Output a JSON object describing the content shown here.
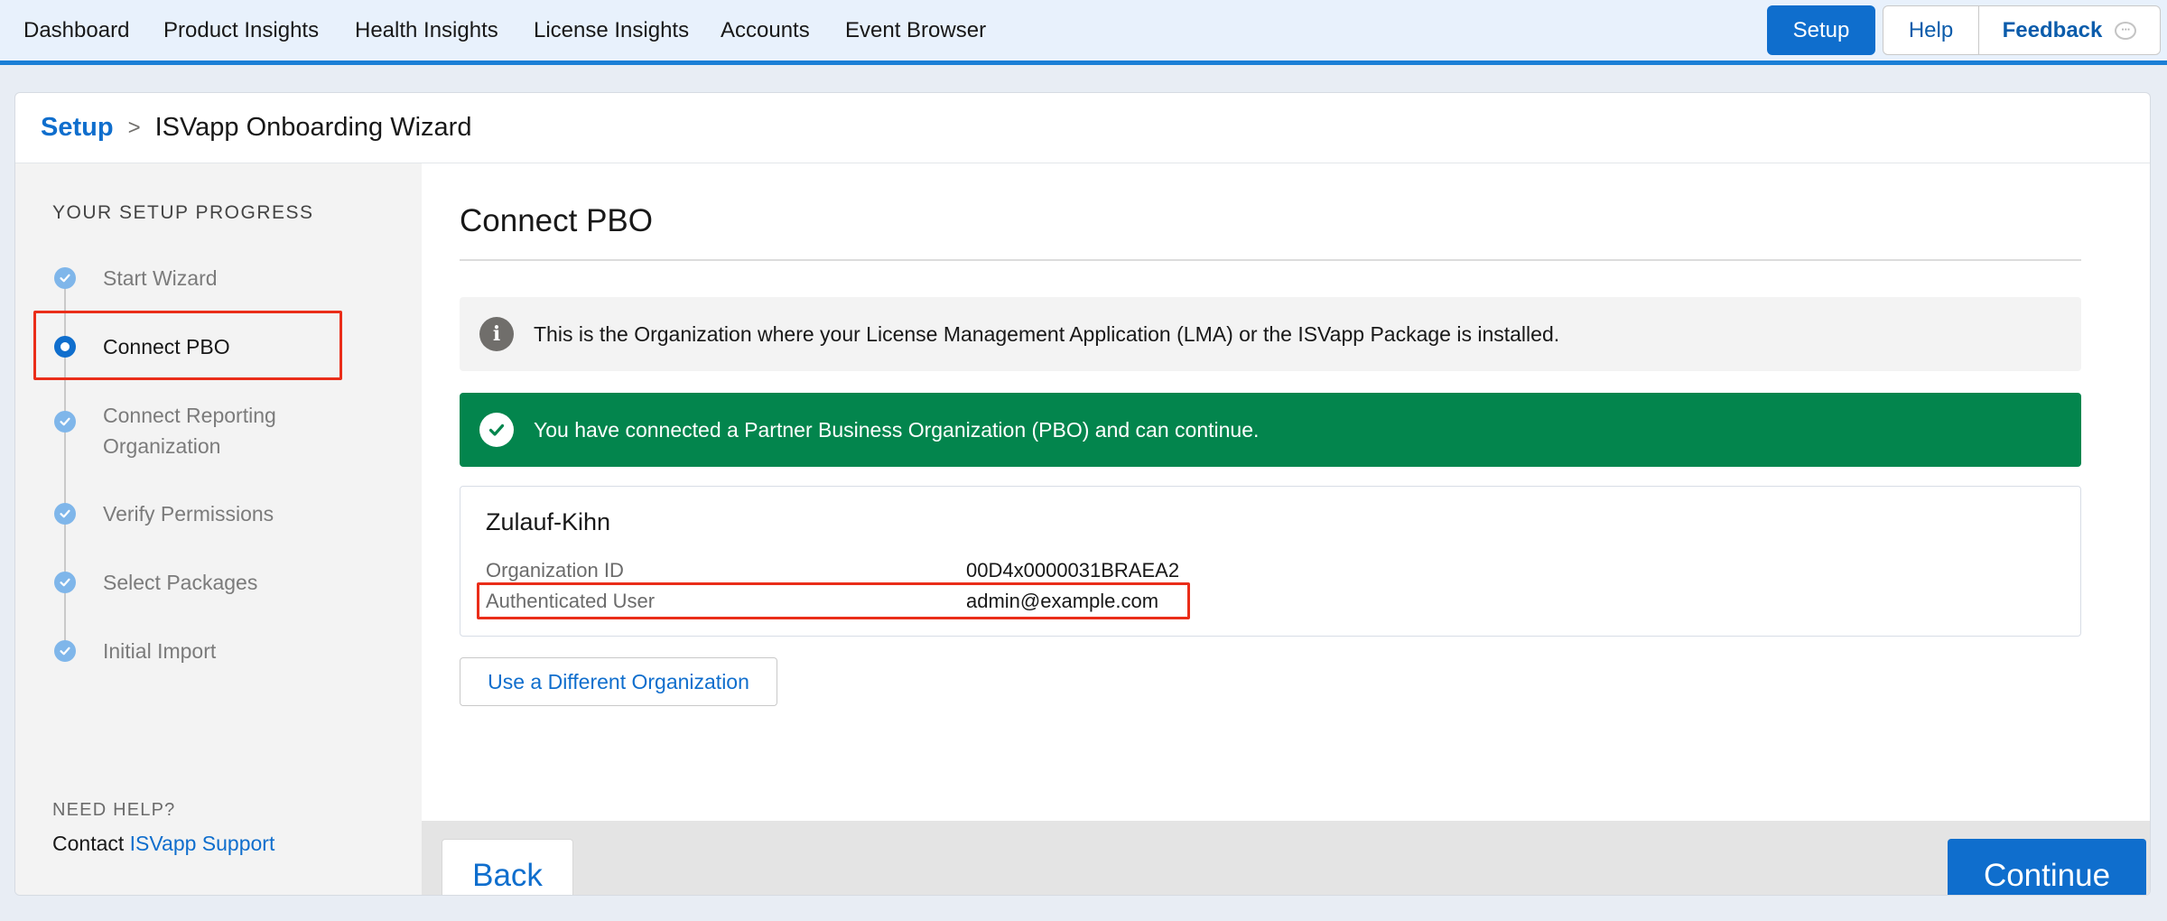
{
  "nav": {
    "items": [
      "Dashboard",
      "Product Insights",
      "Health Insights",
      "License Insights",
      "Accounts",
      "Event Browser"
    ],
    "setup_label": "Setup",
    "help_label": "Help",
    "feedback_label": "Feedback",
    "feedback_icon": "chat-bubble-icon"
  },
  "breadcrumb": {
    "root": "Setup",
    "separator": ">",
    "current": "ISVapp Onboarding Wizard"
  },
  "sidebar": {
    "heading": "YOUR SETUP PROGRESS",
    "steps": [
      {
        "label": "Start Wizard",
        "state": "complete"
      },
      {
        "label": "Connect PBO",
        "state": "current"
      },
      {
        "label": "Connect Reporting",
        "label2": "Organization",
        "state": "complete"
      },
      {
        "label": "Verify Permissions",
        "state": "complete"
      },
      {
        "label": "Select Packages",
        "state": "complete"
      },
      {
        "label": "Initial Import",
        "state": "complete"
      }
    ],
    "help_heading": "NEED HELP?",
    "contact_prefix": "Contact",
    "contact_link": "ISVapp Support"
  },
  "main": {
    "title": "Connect PBO",
    "info_message": "This is the Organization where your License Management Application (LMA) or the ISVapp Package is installed.",
    "success_message": "You have connected a Partner Business Organization (PBO) and can continue.",
    "org": {
      "name": "Zulauf-Kihn",
      "fields": [
        {
          "label": "Organization ID",
          "value": "00D4x0000031BRAEA2"
        },
        {
          "label": "Authenticated User",
          "value": "admin@example.com"
        }
      ]
    },
    "different_org_label": "Use a Different Organization"
  },
  "footer": {
    "back_label": "Back",
    "continue_label": "Continue"
  },
  "colors": {
    "brand": "#0f6ecd",
    "success": "#03854d",
    "highlight": "#ea2d19"
  }
}
